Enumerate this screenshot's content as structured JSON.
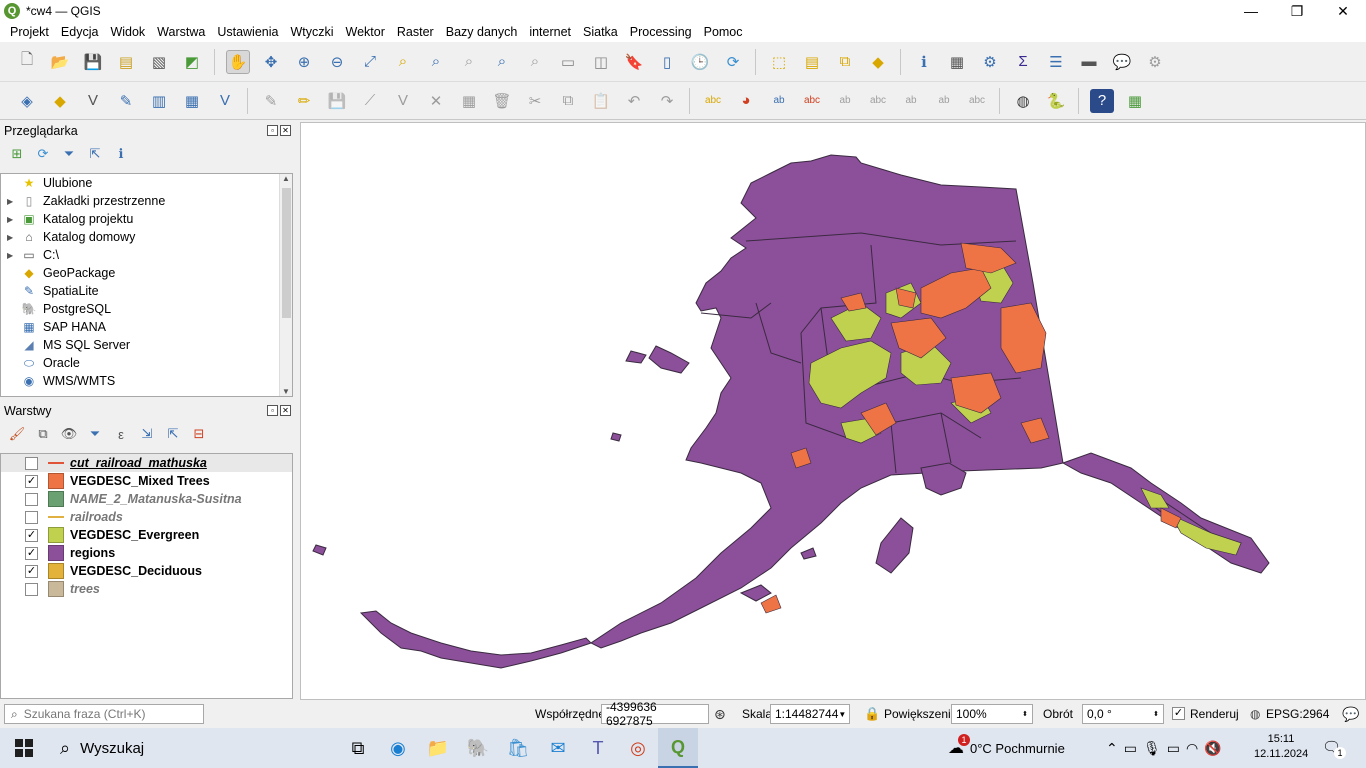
{
  "window": {
    "title": "*cw4 — QGIS",
    "minimize": "—",
    "restore": "❐",
    "close": "✕"
  },
  "menu": [
    "Projekt",
    "Edycja",
    "Widok",
    "Warstwa",
    "Ustawienia",
    "Wtyczki",
    "Wektor",
    "Raster",
    "Bazy danych",
    "internet",
    "Siatka",
    "Processing",
    "Pomoc"
  ],
  "browser": {
    "title": "Przeglądarka",
    "items": [
      {
        "label": "Ulubione",
        "icon": "star-icon",
        "glyph": "★",
        "color": "#e6c200",
        "arrow": false
      },
      {
        "label": "Zakładki przestrzenne",
        "icon": "bookmark-icon",
        "glyph": "▯",
        "color": "#8a8a8a",
        "arrow": true
      },
      {
        "label": "Katalog projektu",
        "icon": "project-folder-icon",
        "glyph": "▣",
        "color": "#4a9a3a",
        "arrow": true
      },
      {
        "label": "Katalog domowy",
        "icon": "home-folder-icon",
        "glyph": "⌂",
        "color": "#555",
        "arrow": true
      },
      {
        "label": "C:\\",
        "icon": "drive-icon",
        "glyph": "▭",
        "color": "#555",
        "arrow": true
      },
      {
        "label": "GeoPackage",
        "icon": "geopackage-icon",
        "glyph": "◆",
        "color": "#d8a800",
        "arrow": false
      },
      {
        "label": "SpatiaLite",
        "icon": "spatialite-icon",
        "glyph": "✎",
        "color": "#3a6fb0",
        "arrow": false
      },
      {
        "label": "PostgreSQL",
        "icon": "postgresql-icon",
        "glyph": "🐘",
        "color": "#336791",
        "arrow": false
      },
      {
        "label": "SAP HANA",
        "icon": "sap-hana-icon",
        "glyph": "▦",
        "color": "#3a6fb0",
        "arrow": false
      },
      {
        "label": "MS SQL Server",
        "icon": "mssql-icon",
        "glyph": "◢",
        "color": "#5a7fb0",
        "arrow": false
      },
      {
        "label": "Oracle",
        "icon": "oracle-icon",
        "glyph": "⬭",
        "color": "#3a6fb0",
        "arrow": false
      },
      {
        "label": "WMS/WMTS",
        "icon": "globe-icon",
        "glyph": "◉",
        "color": "#3a6fb0",
        "arrow": false
      }
    ]
  },
  "layers": {
    "title": "Warstwy",
    "items": [
      {
        "name": "cut_railroad_mathuska",
        "checked": false,
        "kind": "line",
        "color": "#e0543a",
        "style": "ul"
      },
      {
        "name": "VEGDESC_Mixed Trees",
        "checked": true,
        "kind": "fill",
        "color": "#ee7446",
        "style": "on"
      },
      {
        "name": "NAME_2_Matanuska-Susitna",
        "checked": false,
        "kind": "fill",
        "color": "#6aa072",
        "style": "off"
      },
      {
        "name": "railroads",
        "checked": false,
        "kind": "line",
        "color": "#e0b040",
        "style": "off"
      },
      {
        "name": "VEGDESC_Evergreen",
        "checked": true,
        "kind": "fill",
        "color": "#bfd14f",
        "style": "on"
      },
      {
        "name": "regions",
        "checked": true,
        "kind": "fill",
        "color": "#8c4f9a",
        "style": "on"
      },
      {
        "name": "VEGDESC_Deciduous",
        "checked": true,
        "kind": "fill",
        "color": "#e2b23a",
        "style": "on"
      },
      {
        "name": "trees",
        "checked": false,
        "kind": "fill",
        "color": "#c9b99a",
        "style": "off"
      }
    ]
  },
  "map": {
    "colors": {
      "regions": "#8c4f9a",
      "mixed": "#ee7446",
      "evergreen": "#bfd14f",
      "border": "#3a2a40"
    }
  },
  "status": {
    "search_placeholder": "Szukana fraza (Ctrl+K)",
    "coord_label": "Współrzędne",
    "coord_value": "-4399636 6927875",
    "scale_label": "Skala",
    "scale_value": "1:14482744",
    "magnifier_label": "Powiększenie",
    "magnifier_value": "100%",
    "rotation_label": "Obrót",
    "rotation_value": "0,0 °",
    "render_label": "Renderuj",
    "crs": "EPSG:2964"
  },
  "taskbar": {
    "search": "Wyszukaj",
    "weather": "0°C  Pochmurnie",
    "weather_badge": "1",
    "time": "15:11",
    "date": "12.11.2024",
    "notif": "1"
  }
}
